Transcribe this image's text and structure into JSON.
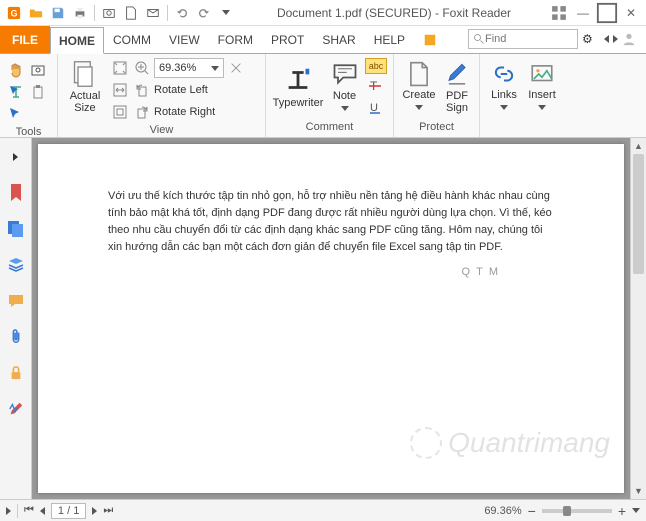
{
  "title": "Document 1.pdf (SECURED) - Foxit Reader",
  "tabs": {
    "file": "FILE",
    "items": [
      "HOME",
      "COMM",
      "VIEW",
      "FORM",
      "PROT",
      "SHAR",
      "HELP"
    ],
    "active": 0
  },
  "search": {
    "placeholder": "Find"
  },
  "ribbon": {
    "tools_label": "Tools",
    "view_label": "View",
    "comment_label": "Comment",
    "protect_label": "Protect",
    "actual_size": "Actual\nSize",
    "zoom_value": "69.36%",
    "rotate_left": "Rotate Left",
    "rotate_right": "Rotate Right",
    "typewriter": "Typewriter",
    "note": "Note",
    "create": "Create",
    "pdf_sign": "PDF\nSign",
    "links": "Links",
    "insert": "Insert"
  },
  "document": {
    "body": "Với ưu thế kích thước tập tin nhỏ gọn, hỗ trợ nhiều nền tảng hệ điều hành khác nhau cùng tính bảo mật khá tốt, định dạng PDF đang được rất nhiều người dùng lựa chọn. Vì thế, kéo theo nhu cầu chuyển đổi từ các định dạng khác sang PDF cũng tăng. Hôm nay, chúng tôi xin hướng dẫn các bạn một cách đơn giản để chuyển file Excel sang tập tin PDF.",
    "qtm": "QTM"
  },
  "status": {
    "page_display": "1 / 1",
    "zoom_display": "69.36%"
  },
  "watermark": "Quantrimang"
}
